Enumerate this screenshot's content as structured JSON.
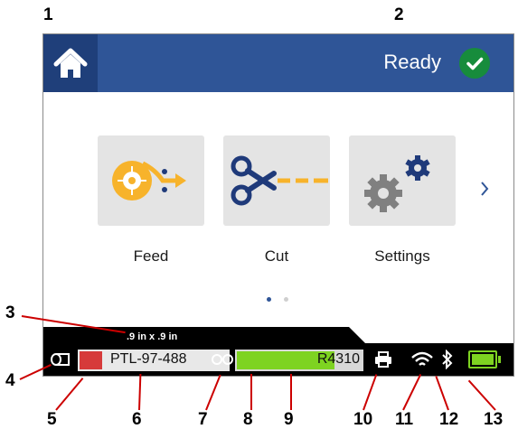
{
  "callouts": [
    "1",
    "2",
    "3",
    "4",
    "5",
    "6",
    "7",
    "8",
    "9",
    "10",
    "11",
    "12",
    "13"
  ],
  "header": {
    "status_text": "Ready",
    "status_icon": "check-icon",
    "home_icon": "home-icon"
  },
  "tiles": [
    {
      "label": "Feed",
      "icon": "feed-icon"
    },
    {
      "label": "Cut",
      "icon": "scissors-icon"
    },
    {
      "label": "Settings",
      "icon": "gears-icon"
    }
  ],
  "pagination": {
    "pages": 2,
    "current": 1
  },
  "status_bar": {
    "label_size": ".9 in x .9 in",
    "label_part": "PTL-97-488",
    "label_color": "#d63a3a",
    "ribbon_part": "R4310",
    "ribbon_remaining": 0.78,
    "battery_level": 1.0
  },
  "colors": {
    "header": "#2f5597",
    "accent_green": "#7ed321",
    "ready_green": "#178c3c",
    "feed_yellow": "#f7b32b",
    "icon_navy": "#1f3a7a",
    "callout_line": "#cc0000"
  }
}
